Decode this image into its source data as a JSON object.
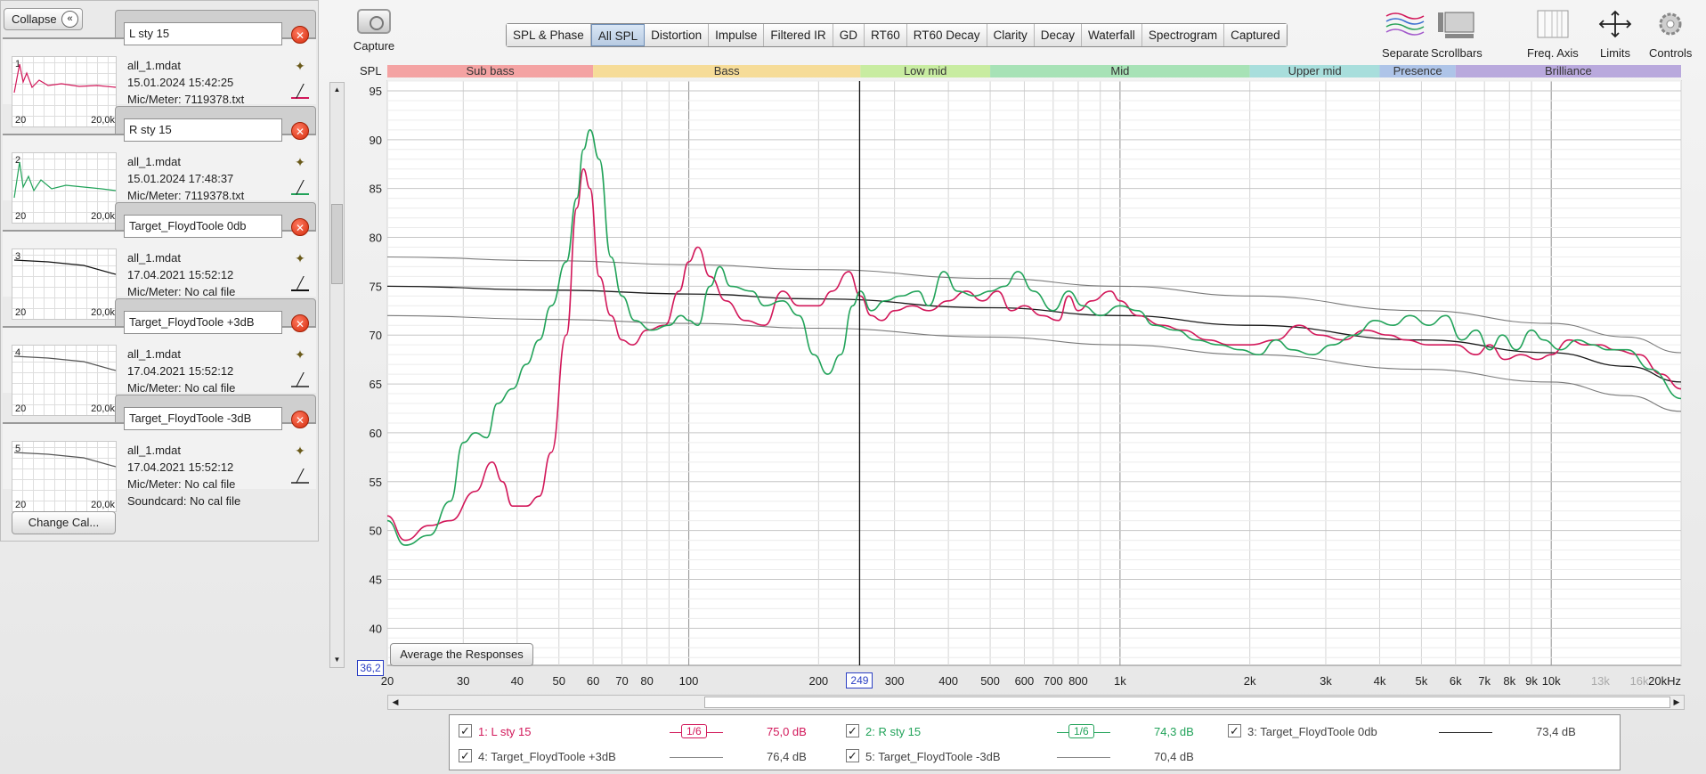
{
  "left_panel": {
    "collapse_label": "Collapse",
    "change_cal_label": "Change Cal...",
    "measurements": [
      {
        "index": "1",
        "name": "L sty 15",
        "file": "all_1.mdat",
        "date": "15.01.2024 15:42:25",
        "mic": "Mic/Meter: 7119378.txt",
        "soundcard": "",
        "axis_left": "20",
        "axis_right": "20,0k",
        "color": "#d2185a"
      },
      {
        "index": "2",
        "name": "R sty 15",
        "file": "all_1.mdat",
        "date": "15.01.2024 17:48:37",
        "mic": "Mic/Meter: 7119378.txt",
        "soundcard": "",
        "axis_left": "20",
        "axis_right": "20,0k",
        "color": "#22a35a"
      },
      {
        "index": "3",
        "name": "Target_FloydToole 0db",
        "file": "all_1.mdat",
        "date": "17.04.2021 15:52:12",
        "mic": "Mic/Meter: No cal file",
        "soundcard": "",
        "axis_left": "20",
        "axis_right": "20,0k",
        "color": "#111111"
      },
      {
        "index": "4",
        "name": "Target_FloydToole +3dB",
        "file": "all_1.mdat",
        "date": "17.04.2021 15:52:12",
        "mic": "Mic/Meter: No cal file",
        "soundcard": "",
        "axis_left": "20",
        "axis_right": "20,0k",
        "color": "#555555"
      },
      {
        "index": "5",
        "name": "Target_FloydToole -3dB",
        "file": "all_1.mdat",
        "date": "17.04.2021 15:52:12",
        "mic": "Mic/Meter: No cal file",
        "soundcard": "Soundcard: No cal file",
        "axis_left": "20",
        "axis_right": "20,0k",
        "color": "#555555"
      }
    ]
  },
  "capture": {
    "label": "Capture"
  },
  "tabs": [
    "SPL & Phase",
    "All SPL",
    "Distortion",
    "Impulse",
    "Filtered IR",
    "GD",
    "RT60",
    "RT60 Decay",
    "Clarity",
    "Decay",
    "Waterfall",
    "Spectrogram",
    "Captured"
  ],
  "active_tab": "All SPL",
  "tools": [
    {
      "label": "Separate",
      "icon": "separate-icon"
    },
    {
      "label": "Scrollbars",
      "icon": "scrollbars-icon"
    },
    {
      "label": "Freq. Axis",
      "icon": "freq-axis-icon"
    },
    {
      "label": "Limits",
      "icon": "limits-icon"
    },
    {
      "label": "Controls",
      "icon": "gear-icon"
    }
  ],
  "graph": {
    "y_axis_label": "SPL",
    "average_button": "Average the Responses",
    "cursor_spl": "36,2",
    "cursor_freq": "249",
    "bands": [
      {
        "name": "Sub bass",
        "from": 20,
        "to": 60,
        "color": "#f4a3a3"
      },
      {
        "name": "Bass",
        "from": 60,
        "to": 250,
        "color": "#f6dc98"
      },
      {
        "name": "Low mid",
        "from": 250,
        "to": 500,
        "color": "#c8eca1"
      },
      {
        "name": "Mid",
        "from": 500,
        "to": 2000,
        "color": "#a7e2b6"
      },
      {
        "name": "Upper mid",
        "from": 2000,
        "to": 4000,
        "color": "#a8dedc"
      },
      {
        "name": "Presence",
        "from": 4000,
        "to": 6000,
        "color": "#aec4e8"
      },
      {
        "name": "Brilliance",
        "from": 6000,
        "to": 20000,
        "color": "#b9a9dd"
      }
    ]
  },
  "chart_data": {
    "type": "line",
    "xlabel": "",
    "ylabel": "SPL",
    "x_scale": "log",
    "xlim": [
      20,
      20000
    ],
    "ylim": [
      36.2,
      96
    ],
    "y_ticks": [
      40,
      45,
      50,
      55,
      60,
      65,
      70,
      75,
      80,
      85,
      90,
      95
    ],
    "x_ticks": [
      {
        "v": 20,
        "label": "20"
      },
      {
        "v": 30,
        "label": "30"
      },
      {
        "v": 40,
        "label": "40"
      },
      {
        "v": 50,
        "label": "50"
      },
      {
        "v": 60,
        "label": "60"
      },
      {
        "v": 70,
        "label": "70"
      },
      {
        "v": 80,
        "label": "80"
      },
      {
        "v": 100,
        "label": "100"
      },
      {
        "v": 200,
        "label": "200"
      },
      {
        "v": 300,
        "label": "300"
      },
      {
        "v": 400,
        "label": "400"
      },
      {
        "v": 500,
        "label": "500"
      },
      {
        "v": 600,
        "label": "600"
      },
      {
        "v": 700,
        "label": "700"
      },
      {
        "v": 800,
        "label": "800"
      },
      {
        "v": 1000,
        "label": "1k"
      },
      {
        "v": 2000,
        "label": "2k"
      },
      {
        "v": 3000,
        "label": "3k"
      },
      {
        "v": 4000,
        "label": "4k"
      },
      {
        "v": 5000,
        "label": "5k"
      },
      {
        "v": 6000,
        "label": "6k"
      },
      {
        "v": 7000,
        "label": "7k"
      },
      {
        "v": 8000,
        "label": "8k"
      },
      {
        "v": 9000,
        "label": "9k"
      },
      {
        "v": 10000,
        "label": "10k"
      },
      {
        "v": 13000,
        "label": "13k"
      },
      {
        "v": 16000,
        "label": "16k"
      },
      {
        "v": 20000,
        "label": "20kHz"
      }
    ],
    "cursor_x": 249,
    "series": [
      {
        "name": "1: L sty 15",
        "color": "#d2185a",
        "width": 1.6,
        "points": [
          [
            20,
            51.5
          ],
          [
            22,
            49
          ],
          [
            25,
            50.5
          ],
          [
            28,
            51
          ],
          [
            32,
            54
          ],
          [
            35,
            57
          ],
          [
            37,
            55
          ],
          [
            39,
            52.5
          ],
          [
            42,
            52.5
          ],
          [
            45,
            53.5
          ],
          [
            48,
            58
          ],
          [
            52,
            70
          ],
          [
            55,
            83
          ],
          [
            57,
            87
          ],
          [
            59,
            85
          ],
          [
            62,
            76
          ],
          [
            66,
            72
          ],
          [
            70,
            69.5
          ],
          [
            74,
            69
          ],
          [
            80,
            70.5
          ],
          [
            88,
            71
          ],
          [
            95,
            74.5
          ],
          [
            100,
            77.5
          ],
          [
            105,
            79
          ],
          [
            112,
            76
          ],
          [
            122,
            73.5
          ],
          [
            135,
            71.5
          ],
          [
            150,
            71
          ],
          [
            165,
            74.5
          ],
          [
            180,
            73
          ],
          [
            200,
            73
          ],
          [
            215,
            74.5
          ],
          [
            235,
            76.5
          ],
          [
            250,
            74
          ],
          [
            265,
            72
          ],
          [
            280,
            71.5
          ],
          [
            300,
            72.5
          ],
          [
            330,
            73
          ],
          [
            360,
            72.5
          ],
          [
            400,
            73.5
          ],
          [
            440,
            74.5
          ],
          [
            480,
            73.5
          ],
          [
            520,
            74.5
          ],
          [
            560,
            72.5
          ],
          [
            600,
            73
          ],
          [
            660,
            72
          ],
          [
            720,
            71.5
          ],
          [
            760,
            74
          ],
          [
            800,
            72.5
          ],
          [
            860,
            73.5
          ],
          [
            950,
            74.5
          ],
          [
            1000,
            73.5
          ],
          [
            1100,
            72
          ],
          [
            1250,
            71
          ],
          [
            1400,
            70.5
          ],
          [
            1600,
            69.5
          ],
          [
            1800,
            69
          ],
          [
            2000,
            69
          ],
          [
            2300,
            69.5
          ],
          [
            2600,
            71
          ],
          [
            2900,
            70
          ],
          [
            3300,
            69.5
          ],
          [
            3700,
            70.5
          ],
          [
            4200,
            70
          ],
          [
            4600,
            69.5
          ],
          [
            5200,
            69
          ],
          [
            6000,
            69
          ],
          [
            6700,
            68
          ],
          [
            7200,
            69
          ],
          [
            7800,
            67.5
          ],
          [
            8500,
            68
          ],
          [
            9300,
            67.5
          ],
          [
            10000,
            68
          ],
          [
            11000,
            69.5
          ],
          [
            12000,
            69
          ],
          [
            13000,
            69
          ],
          [
            14000,
            68.5
          ],
          [
            16000,
            68
          ],
          [
            18000,
            66
          ],
          [
            20000,
            64.5
          ]
        ]
      },
      {
        "name": "2: R sty 15",
        "color": "#22a35a",
        "width": 1.6,
        "points": [
          [
            20,
            51
          ],
          [
            22,
            48.5
          ],
          [
            25,
            49.5
          ],
          [
            28,
            53
          ],
          [
            30,
            59
          ],
          [
            32,
            60
          ],
          [
            34,
            59.5
          ],
          [
            36,
            63
          ],
          [
            39,
            64.5
          ],
          [
            42,
            67
          ],
          [
            45,
            69.5
          ],
          [
            48,
            73
          ],
          [
            52,
            77.5
          ],
          [
            55,
            84
          ],
          [
            57,
            89
          ],
          [
            59,
            91
          ],
          [
            62,
            88
          ],
          [
            66,
            78
          ],
          [
            70,
            74
          ],
          [
            75,
            71.5
          ],
          [
            82,
            70.5
          ],
          [
            90,
            71
          ],
          [
            96,
            72
          ],
          [
            100,
            71.5
          ],
          [
            105,
            71
          ],
          [
            112,
            75
          ],
          [
            118,
            77
          ],
          [
            125,
            75
          ],
          [
            140,
            74.5
          ],
          [
            150,
            73
          ],
          [
            165,
            73.5
          ],
          [
            180,
            72
          ],
          [
            195,
            68
          ],
          [
            210,
            66
          ],
          [
            225,
            68
          ],
          [
            240,
            73
          ],
          [
            250,
            74.5
          ],
          [
            265,
            72.5
          ],
          [
            285,
            73.5
          ],
          [
            310,
            74
          ],
          [
            340,
            74.5
          ],
          [
            360,
            73
          ],
          [
            390,
            76.5
          ],
          [
            420,
            74.5
          ],
          [
            460,
            74
          ],
          [
            500,
            74.5
          ],
          [
            540,
            75
          ],
          [
            580,
            76.5
          ],
          [
            630,
            74.5
          ],
          [
            700,
            72.5
          ],
          [
            760,
            74.5
          ],
          [
            820,
            73
          ],
          [
            900,
            72
          ],
          [
            1000,
            73
          ],
          [
            1100,
            72.5
          ],
          [
            1200,
            71
          ],
          [
            1350,
            70.5
          ],
          [
            1500,
            69.5
          ],
          [
            1700,
            69
          ],
          [
            1900,
            68.5
          ],
          [
            2100,
            68
          ],
          [
            2300,
            69.5
          ],
          [
            2500,
            68.5
          ],
          [
            2800,
            68
          ],
          [
            3100,
            69
          ],
          [
            3500,
            70
          ],
          [
            3900,
            71.5
          ],
          [
            4300,
            71
          ],
          [
            4700,
            72
          ],
          [
            5200,
            71
          ],
          [
            5700,
            72
          ],
          [
            6200,
            69.5
          ],
          [
            6700,
            70.5
          ],
          [
            7200,
            68.5
          ],
          [
            7700,
            70
          ],
          [
            8300,
            68.5
          ],
          [
            9000,
            70.5
          ],
          [
            9600,
            69.5
          ],
          [
            10500,
            68.5
          ],
          [
            11500,
            69.5
          ],
          [
            12500,
            69
          ],
          [
            13500,
            68.5
          ],
          [
            15000,
            68.5
          ],
          [
            17000,
            66.5
          ],
          [
            20000,
            63.5
          ]
        ]
      },
      {
        "name": "3: Target_FloydToole 0db",
        "color": "#1a1a1a",
        "width": 1.3,
        "points": [
          [
            20,
            75
          ],
          [
            50,
            74.6
          ],
          [
            100,
            74.2
          ],
          [
            200,
            73.7
          ],
          [
            500,
            72.8
          ],
          [
            1000,
            72
          ],
          [
            2000,
            71
          ],
          [
            5000,
            69.5
          ],
          [
            10000,
            68.2
          ],
          [
            15000,
            66.8
          ],
          [
            20000,
            65.2
          ]
        ]
      },
      {
        "name": "4: Target_FloydToole +3dB",
        "color": "#7a7a7a",
        "width": 1.1,
        "points": [
          [
            20,
            78
          ],
          [
            50,
            77.6
          ],
          [
            100,
            77.2
          ],
          [
            200,
            76.7
          ],
          [
            500,
            75.8
          ],
          [
            1000,
            75
          ],
          [
            2000,
            74
          ],
          [
            5000,
            72.5
          ],
          [
            10000,
            71.2
          ],
          [
            15000,
            69.8
          ],
          [
            20000,
            68.2
          ]
        ]
      },
      {
        "name": "5: Target_FloydToole -3dB",
        "color": "#7a7a7a",
        "width": 1.1,
        "points": [
          [
            20,
            72
          ],
          [
            50,
            71.6
          ],
          [
            100,
            71.2
          ],
          [
            200,
            70.7
          ],
          [
            500,
            69.8
          ],
          [
            1000,
            69
          ],
          [
            2000,
            68
          ],
          [
            5000,
            66.5
          ],
          [
            10000,
            65.2
          ],
          [
            15000,
            63.8
          ],
          [
            20000,
            62.2
          ]
        ]
      }
    ]
  },
  "legend": [
    {
      "label": "1: L sty 15",
      "value": "75,0 dB",
      "smoothing": "1/6",
      "color": "#d2185a"
    },
    {
      "label": "2: R sty 15",
      "value": "74,3 dB",
      "smoothing": "1/6",
      "color": "#22a35a"
    },
    {
      "label": "3: Target_FloydToole 0db",
      "value": "73,4 dB",
      "smoothing": "",
      "color": "#222222"
    },
    {
      "label": "4: Target_FloydToole +3dB",
      "value": "76,4 dB",
      "smoothing": "",
      "color": "#888888"
    },
    {
      "label": "5: Target_FloydToole -3dB",
      "value": "70,4 dB",
      "smoothing": "",
      "color": "#888888"
    }
  ]
}
